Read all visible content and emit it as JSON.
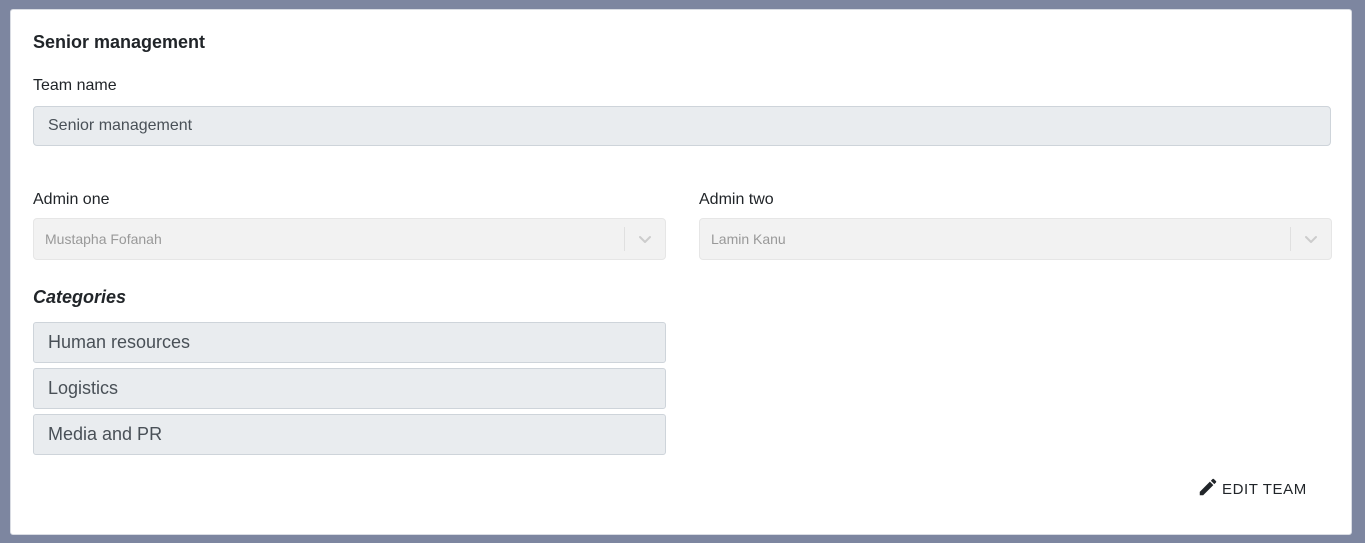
{
  "header": {
    "title": "Senior management"
  },
  "form": {
    "team_name": {
      "label": "Team name",
      "value": "Senior management"
    },
    "admin_one": {
      "label": "Admin one",
      "value": "Mustapha Fofanah",
      "icon": "chevron-down-icon"
    },
    "admin_two": {
      "label": "Admin two",
      "value": "Lamin Kanu",
      "icon": "chevron-down-icon"
    }
  },
  "categories": {
    "title": "Categories",
    "items": [
      {
        "label": "Human resources"
      },
      {
        "label": "Logistics"
      },
      {
        "label": "Media and PR"
      }
    ]
  },
  "actions": {
    "edit_label": "EDIT TEAM",
    "edit_icon": "pencil-icon"
  },
  "colors": {
    "backdrop": "#7d86a0",
    "input_bg": "#e9ecef",
    "select_bg": "#f2f2f2"
  }
}
